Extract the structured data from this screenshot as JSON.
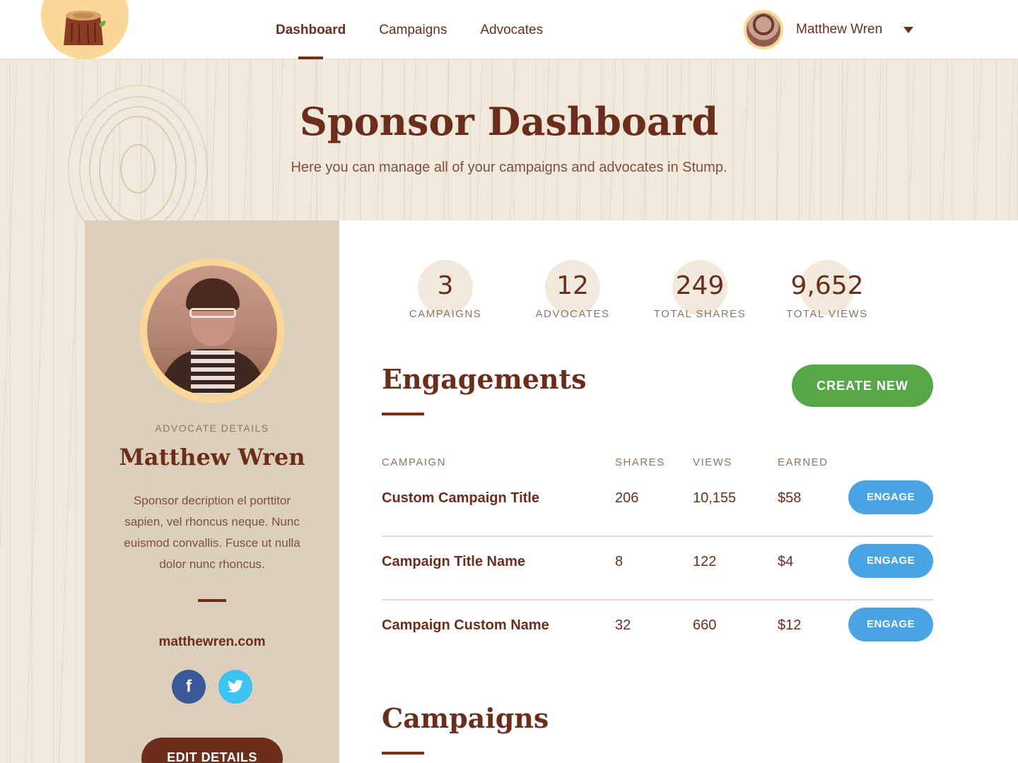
{
  "brand": {
    "name": "stump"
  },
  "nav": {
    "items": [
      {
        "label": "Dashboard"
      },
      {
        "label": "Campaigns"
      },
      {
        "label": "Advocates"
      }
    ]
  },
  "user": {
    "name": "Matthew Wren"
  },
  "hero": {
    "title": "Sponsor Dashboard",
    "subtitle": "Here you can manage all of your campaigns and advocates in Stump."
  },
  "advocate": {
    "label": "ADVOCATE DETAILS",
    "name": "Matthew Wren",
    "description": "Sponsor decription el porttitor sapien, vel rhoncus neque. Nunc euismod convallis. Fusce ut nulla dolor nunc rhoncus.",
    "website": "matthewren.com",
    "social": {
      "facebook": "f",
      "twitter": "t"
    },
    "edit_label": "EDIT DETAILS"
  },
  "stats": [
    {
      "value": "3",
      "label": "CAMPAIGNS"
    },
    {
      "value": "12",
      "label": "ADVOCATES"
    },
    {
      "value": "249",
      "label": "TOTAL SHARES"
    },
    {
      "value": "9,652",
      "label": "TOTAL VIEWS"
    }
  ],
  "engagements": {
    "title": "Engagements",
    "create_label": "CREATE NEW",
    "headers": {
      "campaign": "CAMPAIGN",
      "shares": "SHARES",
      "views": "VIEWS",
      "earned": "EARNED"
    },
    "rows": [
      {
        "campaign": "Custom Campaign Title",
        "shares": "206",
        "views": "10,155",
        "earned": "$58",
        "action": "ENGAGE"
      },
      {
        "campaign": "Campaign Title Name",
        "shares": "8",
        "views": "122",
        "earned": "$4",
        "action": "ENGAGE"
      },
      {
        "campaign": "Campaign Custom Name",
        "shares": "32",
        "views": "660",
        "earned": "$12",
        "action": "ENGAGE"
      }
    ]
  },
  "campaigns_section": {
    "title": "Campaigns"
  },
  "colors": {
    "brown": "#6b2e1c",
    "green": "#55a747",
    "blue": "#4aa3e3",
    "cream": "#f2e9dd",
    "tan": "#dccfbc",
    "gold": "#fcd898"
  }
}
